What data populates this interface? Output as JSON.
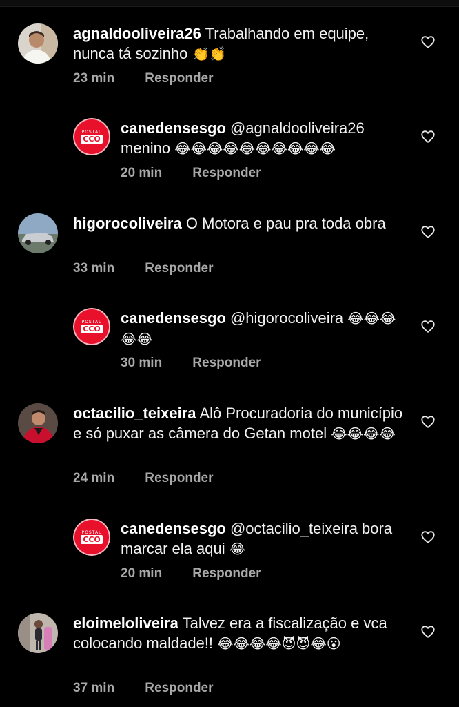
{
  "comments": [
    {
      "username": "agnaldooliveira26",
      "text": "Trabalhando em equipe, nunca tá sozinho",
      "emoji": "👏👏",
      "time": "23 min",
      "reply": "Responder",
      "avatar": "person-avatar"
    },
    {
      "username": "canedensesgo",
      "text": "@agnaldooliveira26 menino",
      "emoji": "😂😂😂😂😂😂😂😂😂😂",
      "time": "20 min",
      "reply": "Responder",
      "avatar": "brand-logo",
      "brand_top": "POSTAL",
      "brand_main": "CCO"
    },
    {
      "username": "higorocoliveira",
      "text": "O Motora e pau pra toda obra",
      "emoji": "",
      "time": "33 min",
      "reply": "Responder",
      "avatar": "car-avatar"
    },
    {
      "username": "canedensesgo",
      "text": "@higorocoliveira",
      "emoji": "😂😂😂😂😂",
      "time": "30 min",
      "reply": "Responder",
      "avatar": "brand-logo",
      "brand_top": "POSTAL",
      "brand_main": "CCO"
    },
    {
      "username": "octacilio_teixeira",
      "text": "Alô Procuradoria do município e só puxar as câmera do Getan motel",
      "emoji": "😂😂😂😂",
      "time": "24 min",
      "reply": "Responder",
      "avatar": "person-avatar"
    },
    {
      "username": "canedensesgo",
      "text": "@octacilio_teixeira bora marcar ela aqui",
      "emoji": "😂",
      "time": "20 min",
      "reply": "Responder",
      "avatar": "brand-logo",
      "brand_top": "POSTAL",
      "brand_main": "CCO"
    },
    {
      "username": "eloimeloliveira",
      "text": "Talvez era a fiscalização e vca colocando maldade!!",
      "emoji": "😂😂😂😂😈😈😂😮",
      "time": "37 min",
      "reply": "Responder",
      "avatar": "person-avatar"
    }
  ],
  "colors": {
    "background": "#000000",
    "meta_text": "#a8a8a8",
    "brand_red": "#e8102a"
  },
  "icons": {
    "like": "heart-outline-icon"
  }
}
